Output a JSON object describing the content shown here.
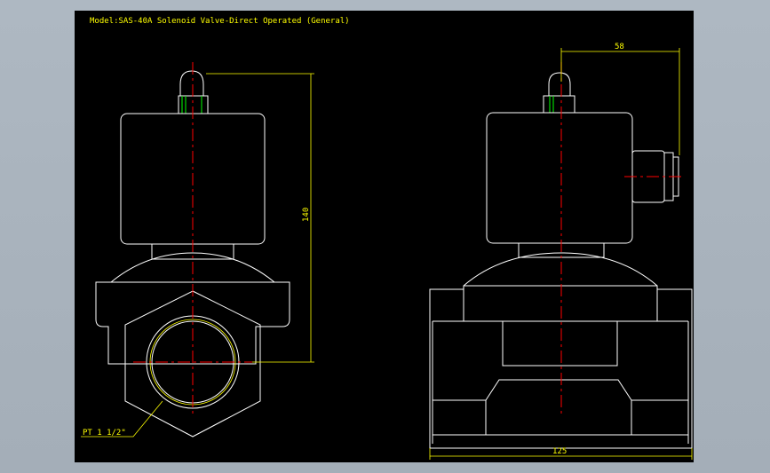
{
  "drawing": {
    "title": "Model:SAS-40A Solenoid Valve-Direct Operated (General)",
    "dims": {
      "height": "140",
      "offset": "58",
      "width": "125",
      "thread": "PT 1 1/2\""
    }
  },
  "colors": {
    "background": "#000000",
    "outline": "#ffffff",
    "dimension": "#ffff00",
    "centerline": "#ff0000",
    "thread_detail": "#00ff00"
  }
}
